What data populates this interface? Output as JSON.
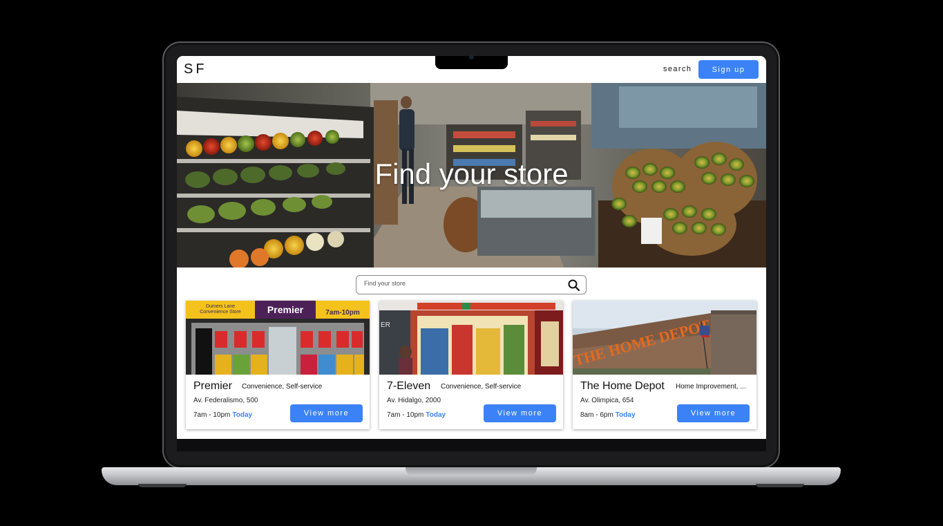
{
  "nav": {
    "logo": "SF",
    "search_label": "search",
    "signup_label": "Sign up"
  },
  "hero": {
    "title": "Find your store",
    "image": "supermarket-produce-aisle"
  },
  "search": {
    "placeholder": "Find your store",
    "icon": "search-icon"
  },
  "stores": [
    {
      "name": "Premier",
      "type": "Convenience, Self-service",
      "address": "Av. Federalismo, 500",
      "hours": "7am - 10pm",
      "day": "Today",
      "button": "View more",
      "image_text": {
        "banner_left": "Dumers Lane Convenience Store",
        "brand": "Premier",
        "hours_sign": "7am-10pm"
      }
    },
    {
      "name": "7-Eleven",
      "type": "Convenience, Self-service",
      "address": "Av. Hidalgo, 2000",
      "hours": "7am - 10pm",
      "day": "Today",
      "button": "View more",
      "image_text": {
        "window": "ER"
      }
    },
    {
      "name": "The Home Depot",
      "type": "Home Improvement, ...",
      "address": "Av. Olimpica, 654",
      "hours": "8am - 6pm",
      "day": "Today",
      "button": "View more",
      "image_text": {
        "sign": "THE HOME DEPOT"
      }
    }
  ],
  "colors": {
    "accent": "#3b82f6",
    "background": "#000000"
  }
}
